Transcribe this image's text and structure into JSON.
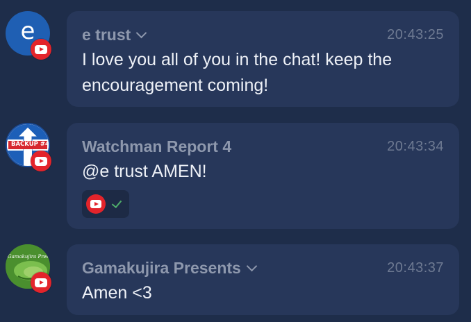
{
  "messages": [
    {
      "author": "e trust",
      "time": "20:43:25",
      "text": "I love you all of you in the chat! keep the encouragement coming!",
      "avatar_letter": "e",
      "avatar_color": "#1f5fb3",
      "has_dropdown": true
    },
    {
      "author": "Watchman Report 4",
      "time": "20:43:34",
      "text": "@e trust AMEN!",
      "avatar_label": "BACKUP #4",
      "has_dropdown": false,
      "reaction": {
        "icon": "youtube-icon",
        "check": "check-icon"
      }
    },
    {
      "author": "Gamakujira Presents",
      "time": "20:43:37",
      "text": "Amen <3",
      "avatar_label": "Gamakujira Presents",
      "avatar_color": "#4a8f2e",
      "has_dropdown": true
    }
  ],
  "colors": {
    "background": "#1e2d4a",
    "bubble": "#27375a",
    "youtube_red": "#e3242b",
    "check_green": "#4fae6b"
  }
}
